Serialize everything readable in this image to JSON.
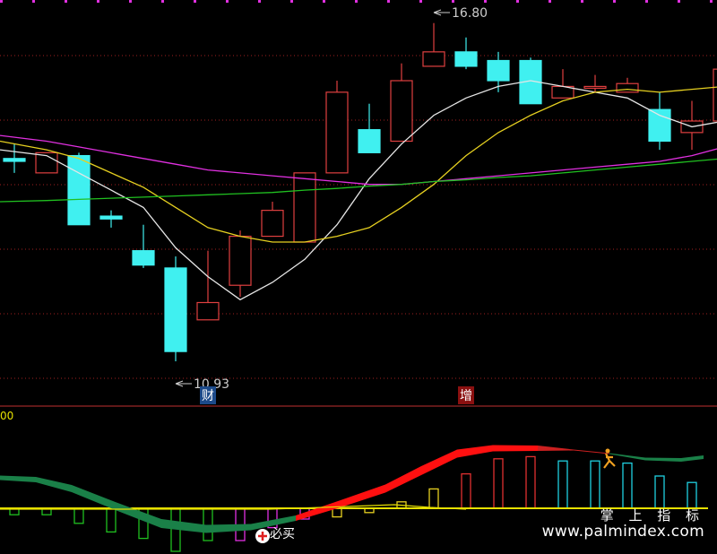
{
  "chart_data": [
    {
      "type": "candlestick",
      "title": "",
      "ylim": [
        10.2,
        17.2
      ],
      "grid": true,
      "candles": [
        {
          "o": 14.45,
          "h": 14.7,
          "l": 14.2,
          "c": 14.4
        },
        {
          "o": 14.2,
          "h": 14.5,
          "l": 14.2,
          "c": 14.55
        },
        {
          "o": 14.5,
          "h": 14.55,
          "l": 13.3,
          "c": 13.3
        },
        {
          "o": 13.45,
          "h": 13.55,
          "l": 13.25,
          "c": 13.4
        },
        {
          "o": 12.85,
          "h": 13.3,
          "l": 12.55,
          "c": 12.6
        },
        {
          "o": 12.55,
          "h": 12.75,
          "l": 10.93,
          "c": 11.1
        },
        {
          "o": 11.65,
          "h": 12.85,
          "l": 11.7,
          "c": 11.95
        },
        {
          "o": 12.25,
          "h": 13.2,
          "l": 12.05,
          "c": 13.1
        },
        {
          "o": 13.1,
          "h": 13.7,
          "l": 13.1,
          "c": 13.55
        },
        {
          "o": 13.0,
          "h": 13.7,
          "l": 13.0,
          "c": 14.2
        },
        {
          "o": 14.2,
          "h": 15.8,
          "l": 14.3,
          "c": 15.6
        },
        {
          "o": 14.95,
          "h": 15.4,
          "l": 14.7,
          "c": 14.55
        },
        {
          "o": 14.75,
          "h": 16.1,
          "l": 14.75,
          "c": 15.8
        },
        {
          "o": 16.05,
          "h": 16.8,
          "l": 16.05,
          "c": 16.3
        },
        {
          "o": 16.3,
          "h": 16.55,
          "l": 16.0,
          "c": 16.05
        },
        {
          "o": 16.15,
          "h": 16.3,
          "l": 15.6,
          "c": 15.8
        },
        {
          "o": 16.15,
          "h": 16.2,
          "l": 15.4,
          "c": 15.4
        },
        {
          "o": 15.5,
          "h": 16.0,
          "l": 15.5,
          "c": 15.7
        },
        {
          "o": 15.7,
          "h": 15.9,
          "l": 15.6,
          "c": 15.7
        },
        {
          "o": 15.6,
          "h": 15.85,
          "l": 15.6,
          "c": 15.75
        },
        {
          "o": 15.3,
          "h": 15.6,
          "l": 14.6,
          "c": 14.75
        },
        {
          "o": 14.9,
          "h": 15.45,
          "l": 14.6,
          "c": 15.1
        },
        {
          "o": 15.1,
          "h": 16.1,
          "l": 15.1,
          "c": 16.0
        }
      ],
      "series": [
        {
          "values": [
            14.6,
            14.5,
            14.2,
            13.9,
            13.6,
            12.9,
            12.4,
            12.0,
            12.3,
            12.7,
            13.3,
            14.1,
            14.7,
            15.2,
            15.5,
            15.7,
            15.8,
            15.7,
            15.6,
            15.5,
            15.2,
            15.0,
            15.1
          ],
          "color": "#e6e6e6"
        },
        {
          "values": [
            14.75,
            14.6,
            14.45,
            14.2,
            13.95,
            13.6,
            13.25,
            13.1,
            13.0,
            13.0,
            13.1,
            13.25,
            13.6,
            14.0,
            14.5,
            14.9,
            15.2,
            15.45,
            15.6,
            15.65,
            15.6,
            15.65,
            15.7
          ],
          "color": "#e6d020"
        },
        {
          "values": [
            14.85,
            14.75,
            14.65,
            14.55,
            14.45,
            14.35,
            14.25,
            14.2,
            14.15,
            14.1,
            14.05,
            14.0,
            14.0,
            14.05,
            14.1,
            14.15,
            14.2,
            14.25,
            14.3,
            14.35,
            14.4,
            14.5,
            14.65
          ],
          "color": "#e030e0"
        },
        {
          "values": [
            13.7,
            13.72,
            13.74,
            13.76,
            13.78,
            13.8,
            13.82,
            13.84,
            13.86,
            13.9,
            13.93,
            13.97,
            14.0,
            14.05,
            14.08,
            14.12,
            14.15,
            14.2,
            14.25,
            14.3,
            14.35,
            14.4,
            14.45
          ],
          "color": "#20c020"
        }
      ],
      "annotations": [
        {
          "text": "16.80",
          "index": 13,
          "value": 16.8
        },
        {
          "text": "10.93",
          "index": 5,
          "value": 10.93
        },
        {
          "text": "财",
          "index": 6
        },
        {
          "text": "增",
          "index": 14
        }
      ]
    },
    {
      "type": "bar",
      "ylim": [
        -40,
        80
      ],
      "axis_label": "00",
      "values": [
        -6,
        -6,
        -14,
        -22,
        -28,
        -40,
        -30,
        -30,
        -18,
        -10,
        -8,
        -4,
        6,
        18,
        32,
        46,
        48,
        44,
        44,
        42,
        30,
        24,
        26
      ],
      "colors": [
        "#20c020",
        "#20c020",
        "#20c020",
        "#20c020",
        "#20c020",
        "#20c020",
        "#20c020",
        "#e030e0",
        "#e030e0",
        "#e030e0",
        "#e6d020",
        "#e6d020",
        "#e6d020",
        "#e6d020",
        "#e03030",
        "#e03030",
        "#e03030",
        "#20d0e0",
        "#20d0e0",
        "#20d0e0",
        "#20d0e0",
        "#20d0e0",
        "#e03030"
      ],
      "labels": [
        {
          "text": "必买",
          "index": 8
        }
      ]
    }
  ],
  "watermark": {
    "chinese": "掌 上 指 标",
    "url": "www.palmindex.com"
  }
}
